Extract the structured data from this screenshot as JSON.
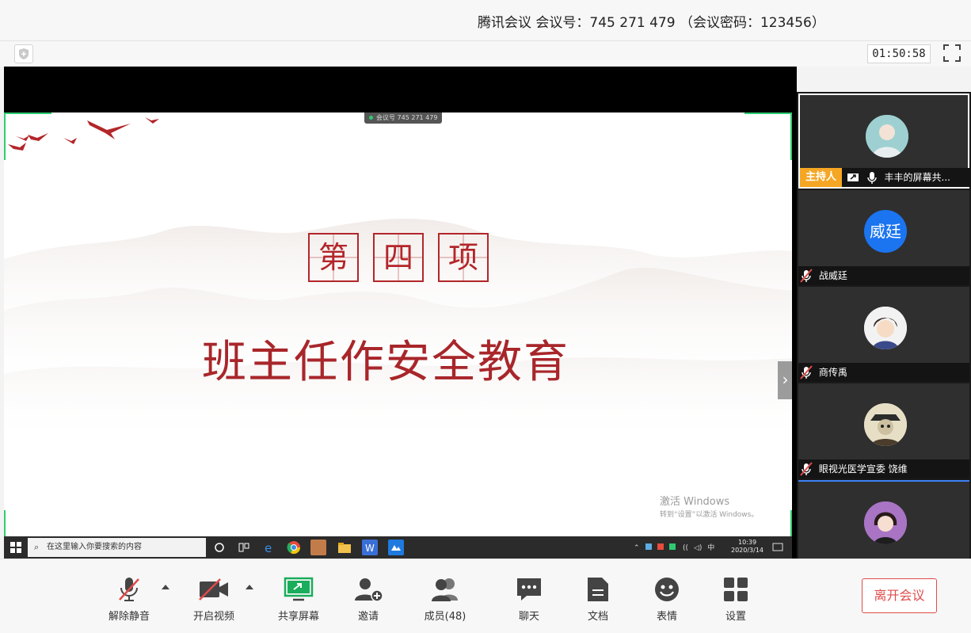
{
  "window": {
    "title": "腾讯会议 会议号：745 271 479 （会议密码：123456）"
  },
  "infobar": {
    "timer": "01:50:58"
  },
  "shared_screen": {
    "meeting_tag": "会议号 745 271 479",
    "box_chars": [
      "第",
      "四",
      "项"
    ],
    "main_title": "班主任作安全教育",
    "activate_line1": "激活 Windows",
    "activate_line2": "转到“设置”以激活 Windows。",
    "taskbar": {
      "search_placeholder": "在这里输入你要搜索的内容",
      "ime": "中",
      "time": "10:39",
      "date": "2020/3/14"
    }
  },
  "participants": [
    {
      "name": "丰丰的屏幕共...",
      "role": "主持人",
      "avatar": "photo"
    },
    {
      "name": "战威廷",
      "avatar_text": "威廷"
    },
    {
      "name": "商传禹",
      "avatar": "cartoon"
    },
    {
      "name": "眼视光医学宣委 饶维",
      "avatar": "cartoon"
    },
    {
      "name": "",
      "avatar": "cartoon"
    }
  ],
  "toolbar": {
    "unmute": "解除静音",
    "start_video": "开启视频",
    "share_screen": "共享屏幕",
    "invite": "邀请",
    "members": "成员(48)",
    "chat": "聊天",
    "docs": "文档",
    "reactions": "表情",
    "settings": "设置",
    "leave": "离开会议"
  },
  "colors": {
    "accent_red": "#e04b4b",
    "slide_red": "#b3262a",
    "share_green": "#1aad5b",
    "host_orange": "#f5a623",
    "avatar_blue": "#1b74f0"
  }
}
